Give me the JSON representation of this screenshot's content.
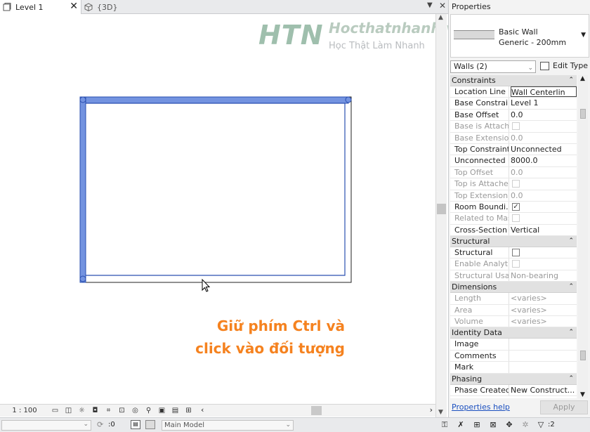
{
  "tabs": [
    {
      "label": "Level 1",
      "close": "✕"
    },
    {
      "label": "{3D}"
    }
  ],
  "tabbar": {
    "chevron": "▼",
    "close": "✕"
  },
  "watermark": {
    "letters": "HTN",
    "brand": "Hocthatnhanh.vn",
    "tagline": "Học Thật  Làm Nhanh"
  },
  "caption": {
    "line1": "Giữ phím Ctrl và",
    "line2": "click vào đối tượng"
  },
  "view_control": {
    "scale": "1 : 100",
    "icons": [
      "detail-level-icon",
      "visual-style-icon",
      "sun-path-icon",
      "shadows-icon",
      "crop-view-icon",
      "show-crop-icon",
      "temporary-hide-icon",
      "reveal-hidden-icon",
      "lock-3d-icon",
      "worksharing-display-icon",
      "analytical-model-icon"
    ],
    "arrow_left": "‹",
    "arrow_right": "›"
  },
  "statusbar": {
    "sync_count": ":0",
    "model": "Main Model",
    "filter_count": ":2"
  },
  "properties": {
    "title": "Properties",
    "type_family": "Basic Wall",
    "type_name": "Generic - 200mm",
    "filter": "Walls (2)",
    "edit_type": "Edit Type",
    "help": "Properties help",
    "apply": "Apply",
    "groups": [
      {
        "name": "Constraints",
        "rows": [
          {
            "name": "Location Line",
            "value": "Wall Centerlin",
            "editing": true
          },
          {
            "name": "Base Constraint",
            "value": "Level 1"
          },
          {
            "name": "Base Offset",
            "value": "0.0"
          },
          {
            "name": "Base is Attach...",
            "value": "",
            "check": false,
            "disabled": true
          },
          {
            "name": "Base Extensio...",
            "value": "0.0",
            "disabled": true
          },
          {
            "name": "Top Constraint",
            "value": "Unconnected"
          },
          {
            "name": "Unconnected ...",
            "value": "8000.0"
          },
          {
            "name": "Top Offset",
            "value": "0.0",
            "disabled": true
          },
          {
            "name": "Top is Attached",
            "value": "",
            "check": false,
            "disabled": true
          },
          {
            "name": "Top Extension...",
            "value": "0.0",
            "disabled": true
          },
          {
            "name": "Room Boundi...",
            "value": "",
            "check": true
          },
          {
            "name": "Related to Mass",
            "value": "",
            "check": false,
            "disabled": true
          },
          {
            "name": "Cross-Section",
            "value": "Vertical"
          }
        ]
      },
      {
        "name": "Structural",
        "rows": [
          {
            "name": "Structural",
            "value": "",
            "check": false
          },
          {
            "name": "Enable Analyti...",
            "value": "",
            "check": false,
            "disabled": true
          },
          {
            "name": "Structural Usa...",
            "value": "Non-bearing",
            "disabled": true
          }
        ]
      },
      {
        "name": "Dimensions",
        "rows": [
          {
            "name": "Length",
            "value": "<varies>",
            "disabled": true
          },
          {
            "name": "Area",
            "value": "<varies>",
            "disabled": true
          },
          {
            "name": "Volume",
            "value": "<varies>",
            "disabled": true
          }
        ]
      },
      {
        "name": "Identity Data",
        "rows": [
          {
            "name": "Image",
            "value": ""
          },
          {
            "name": "Comments",
            "value": ""
          },
          {
            "name": "Mark",
            "value": ""
          }
        ]
      },
      {
        "name": "Phasing",
        "rows": [
          {
            "name": "Phase Created",
            "value": "New Construct..."
          }
        ]
      }
    ]
  },
  "colors": {
    "selection_blue": "#7393e0",
    "caption_orange": "#f5821f",
    "link_blue": "#1a4fbf"
  }
}
